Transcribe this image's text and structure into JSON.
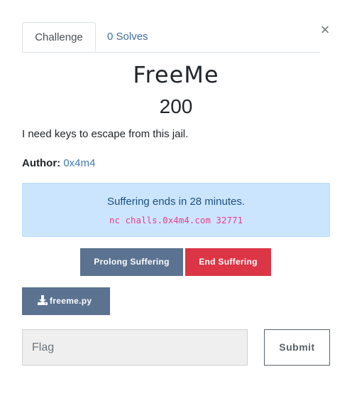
{
  "tabs": [
    {
      "label": "Challenge",
      "active": true
    },
    {
      "label": "0 Solves",
      "active": false
    }
  ],
  "close_glyph": "×",
  "challenge": {
    "name": "FreeMe",
    "value": "200",
    "description": "I need keys to escape from this jail.",
    "author_label": "Author:",
    "author": "0x4m4"
  },
  "instance": {
    "status": "Suffering ends in 28 minutes.",
    "connection": "nc challs.0x4m4.com 32771"
  },
  "buttons": {
    "prolong": "Prolong Suffering",
    "end": "End Suffering",
    "download": "freeme.py",
    "submit": "Submit"
  },
  "flag_input": {
    "placeholder": "Flag",
    "value": ""
  },
  "icons": {
    "download": "download-icon",
    "close": "close-icon"
  },
  "colors": {
    "primary_button": "#5b7290",
    "danger_button": "#dc3545",
    "info_background": "#cce5ff",
    "link": "#3d7ab5",
    "code": "#e83e8c"
  }
}
